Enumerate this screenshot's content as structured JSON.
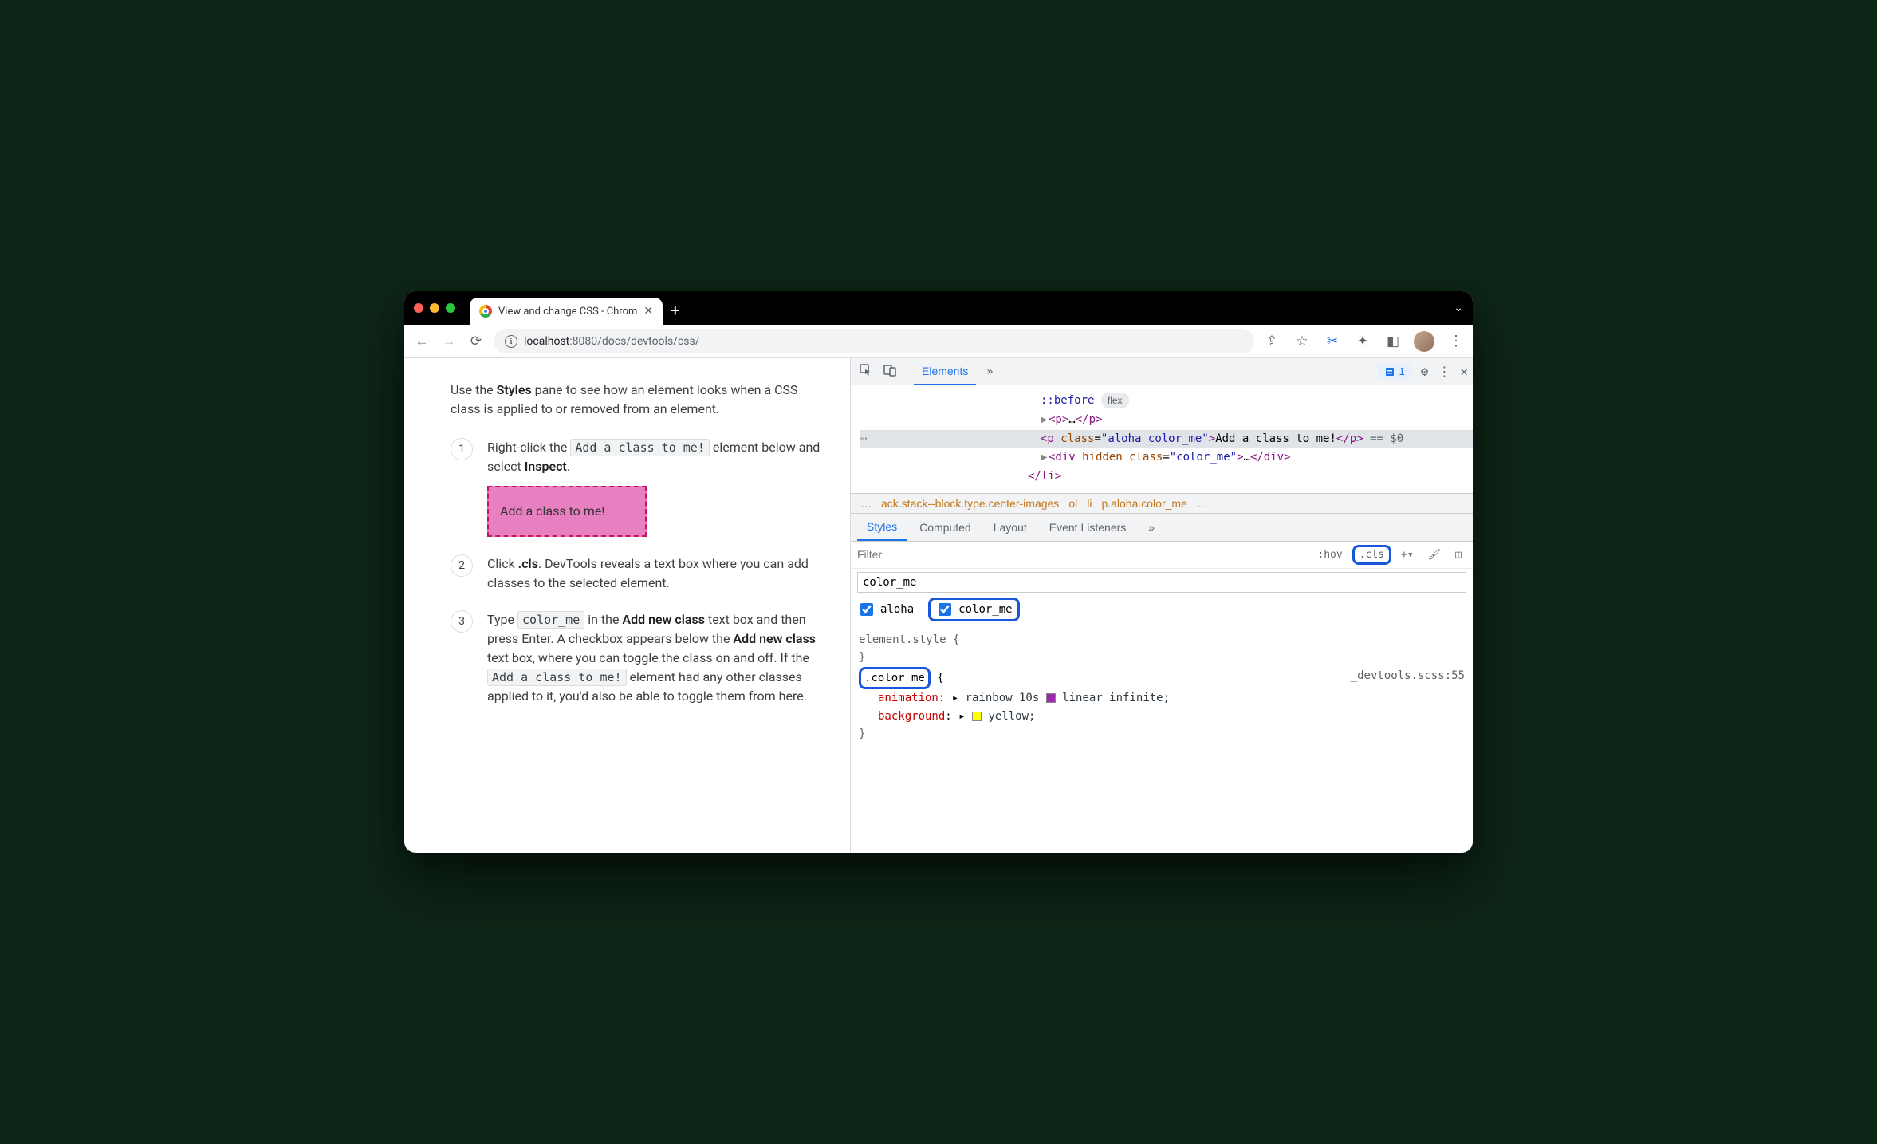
{
  "browser": {
    "tab_title": "View and change CSS - Chrom",
    "url_host": "localhost",
    "url_port": ":8080",
    "url_path": "/docs/devtools/css/"
  },
  "page": {
    "intro_pre": "Use the ",
    "intro_b1": "Styles",
    "intro_post": " pane to see how an element looks when a CSS class is applied to or removed from an element.",
    "s1_pre": "Right-click the ",
    "s1_code": "Add a class to me!",
    "s1_mid": " element below and select ",
    "s1_b": "Inspect",
    "s1_post": ".",
    "demo_text": "Add a class to me!",
    "s2_pre": "Click ",
    "s2_b": ".cls",
    "s2_post": ". DevTools reveals a text box where you can add classes to the selected element.",
    "s3_pre": "Type ",
    "s3_code1": "color_me",
    "s3_mid1": " in the ",
    "s3_b1": "Add new class",
    "s3_mid2": " text box and then press Enter. A checkbox appears below the ",
    "s3_b2": "Add new class",
    "s3_mid3": " text box, where you can toggle the class on and off. If the ",
    "s3_code2": "Add a class to me!",
    "s3_post": " element had any other classes applied to it, you'd also be able to toggle them from here."
  },
  "devtools": {
    "tabs": {
      "elements": "Elements"
    },
    "issues_count": "1",
    "dom": {
      "before": "::before",
      "flex_pill": "flex",
      "p_collapsed_open": "<p>",
      "p_collapsed_ell": "…",
      "p_collapsed_close": "</p>",
      "sel_open": "<p ",
      "sel_attr": "class",
      "sel_eq": "=",
      "sel_val": "\"aloha color_me\"",
      "sel_close": ">",
      "sel_text": "Add a class to me!",
      "sel_endtag": "</p>",
      "eq0": " == $0",
      "div_open": "<div ",
      "div_attr1": "hidden ",
      "div_attr2": "class",
      "div_val": "\"color_me\"",
      "div_close": ">",
      "div_ell": "…",
      "div_end": "</div>",
      "li_close": "</li>"
    },
    "breadcrumb": {
      "b0": "…",
      "b1": "ack.stack--block.type.center-images",
      "b2": "ol",
      "b3": "li",
      "b4": "p.aloha.color_me",
      "b5": "…"
    },
    "subtabs": {
      "styles": "Styles",
      "computed": "Computed",
      "layout": "Layout",
      "event": "Event Listeners"
    },
    "filter_placeholder": "Filter",
    "hov": ":hov",
    "cls": ".cls",
    "cls_input_value": "color_me",
    "check1": "aloha",
    "check2": "color_me",
    "rule_element": "element.style {",
    "rule_close": "}",
    "rule2_sel": ".color_me",
    "rule2_brace": " {",
    "rule2_src": "_devtools.scss:55",
    "prop1": "animation",
    "pval1_a": "rainbow 10s ",
    "pval1_b": "linear infinite;",
    "prop2": "background",
    "pval2": "yellow;"
  }
}
